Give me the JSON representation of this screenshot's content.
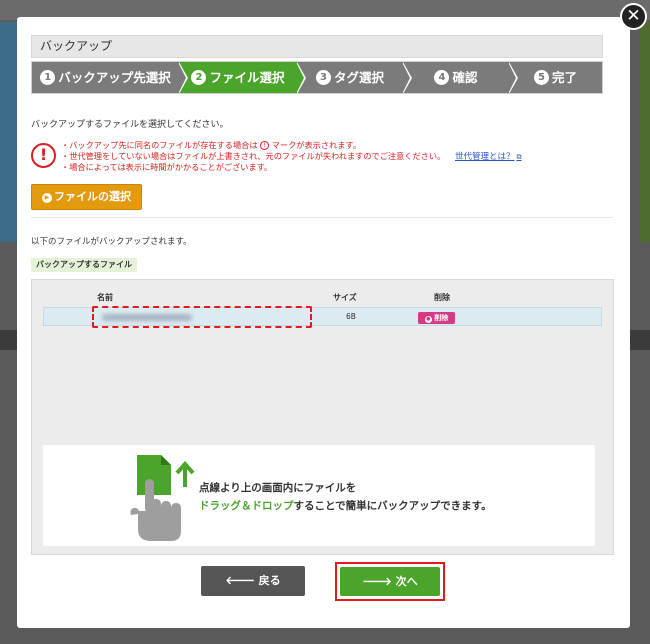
{
  "dialog": {
    "title": "バックアップ",
    "close_glyph": "✕"
  },
  "steps": [
    {
      "num": "1",
      "label": "バックアップ先選択",
      "active": false
    },
    {
      "num": "2",
      "label": "ファイル選択",
      "active": true
    },
    {
      "num": "3",
      "label": "タグ選択",
      "active": false
    },
    {
      "num": "4",
      "label": "確認",
      "active": false
    },
    {
      "num": "5",
      "label": "完了",
      "active": false
    }
  ],
  "instruction": "バックアップするファイルを選択してください。",
  "warnings": {
    "line1_a": "・バックアップ先に同名のファイルが存在する場合は",
    "line1_icon": "!",
    "line1_b": "マークが表示されます。",
    "line2": "・世代管理をしていない場合はファイルが上書きされ、元のファイルが失われますのでご注意ください。",
    "line3": "・場合によっては表示に時間がかかることがございます。",
    "link": "世代管理とは？"
  },
  "file_select_button": "ファイルの選択",
  "below_text": "以下のファイルがバックアップされます。",
  "section_label": "バックアップするファイル",
  "table": {
    "headers": {
      "name": "名前",
      "size": "サイズ",
      "delete": "削除"
    },
    "rows": [
      {
        "size": "6B",
        "delete_label": "削除"
      }
    ]
  },
  "drop_hint": {
    "line1": "点線より上の画面内にファイルを",
    "line2_highlight": "ドラッグ＆ドロップ",
    "line2_rest": "することで簡単にバックアップできます。"
  },
  "buttons": {
    "back": "戻る",
    "next": "次へ"
  },
  "colors": {
    "accent_green": "#4aa52a",
    "orange": "#e39a0d",
    "warning_red": "#d81e1e",
    "delete_pink": "#d63a84"
  }
}
